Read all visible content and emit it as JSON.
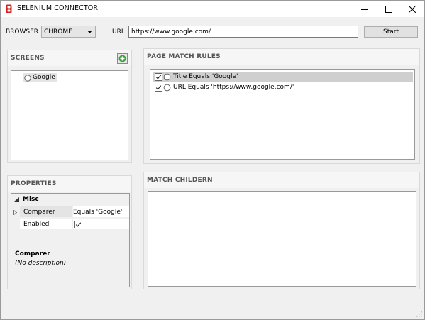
{
  "window": {
    "title": "SELENIUM CONNECTOR",
    "app_icon": "selenium-icon",
    "controls": [
      "minimize-icon",
      "maximize-icon",
      "close-icon"
    ]
  },
  "toolbar": {
    "browser_label": "BROWSER",
    "browser_value": "CHROME",
    "url_label": "URL",
    "url_value": "https://www.google.com/",
    "start_label": "Start"
  },
  "screens": {
    "header": "SCREENS",
    "add_icon": "plus-circle-icon",
    "items": [
      {
        "label": "Google",
        "selected": true
      }
    ]
  },
  "properties": {
    "header": "PROPERTIES",
    "category": "Misc",
    "rows": [
      {
        "name": "Comparer",
        "value": "Equals 'Google'"
      },
      {
        "name": "Enabled",
        "value": "",
        "checked": true
      }
    ],
    "description_title": "Comparer",
    "description_text": "(No description)"
  },
  "page_match_rules": {
    "header": "PAGE MATCH RULES",
    "rules": [
      {
        "label": "Title Equals 'Google'",
        "checked": true,
        "selected": true
      },
      {
        "label": "URL Equals 'https://www.google.com/'",
        "checked": true,
        "selected": false
      }
    ]
  },
  "match_children": {
    "header": "MATCH CHILDERN"
  },
  "colors": {
    "window_bg": "#f0f0f0",
    "selection": "#cfcfcf",
    "add_icon_green": "#3aa13a",
    "app_icon_red": "#d62020"
  }
}
